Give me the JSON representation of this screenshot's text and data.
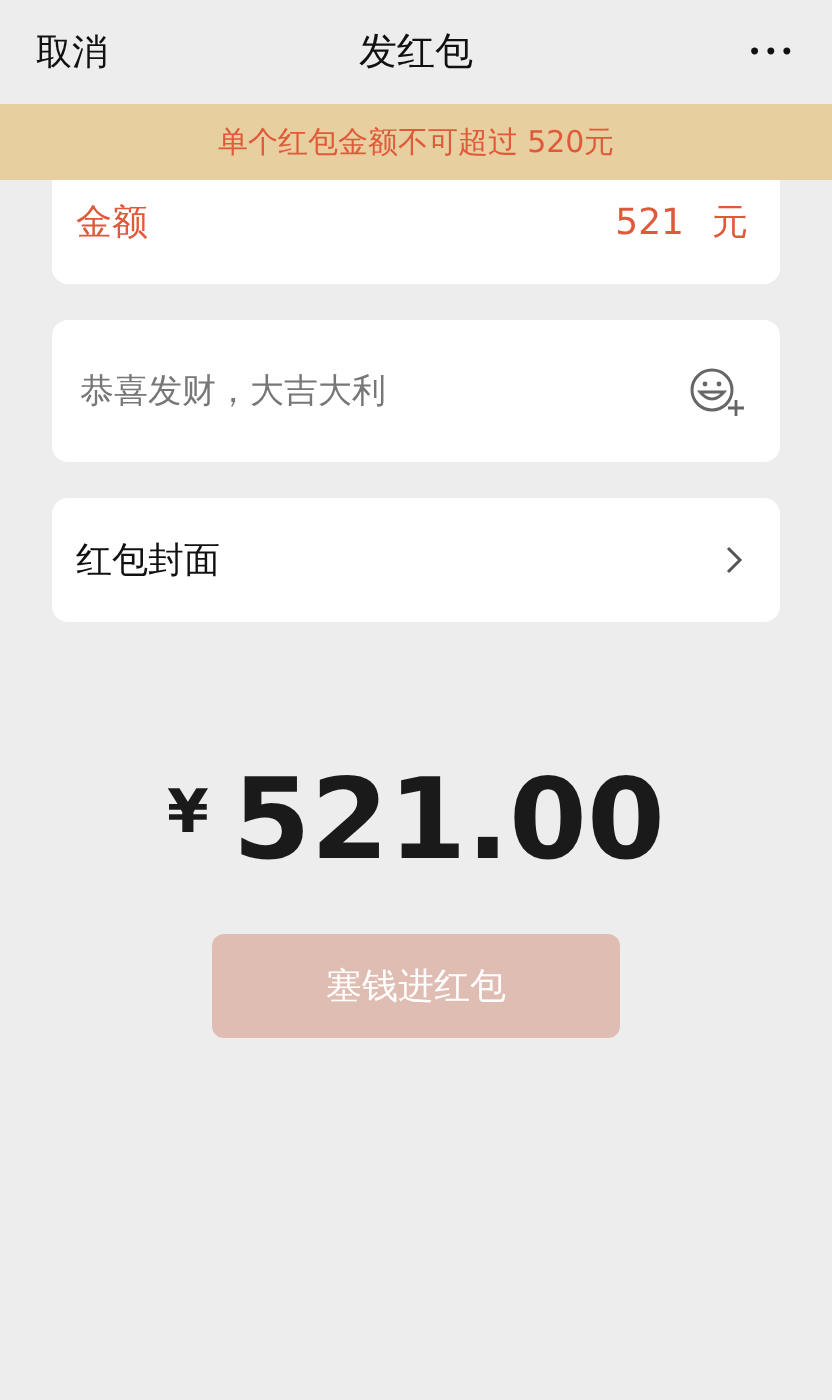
{
  "nav": {
    "cancel": "取消",
    "title": "发红包",
    "more": "•••"
  },
  "warning": "单个红包金额不可超过 520元",
  "amount_field": {
    "label": "金额",
    "value": "521",
    "unit": "元",
    "error": true
  },
  "greeting_field": {
    "placeholder": "恭喜发财，大吉大利"
  },
  "cover_row": {
    "label": "红包封面"
  },
  "total": {
    "currency": "¥",
    "value": "521.00"
  },
  "submit": {
    "label": "塞钱进红包",
    "disabled": true
  }
}
